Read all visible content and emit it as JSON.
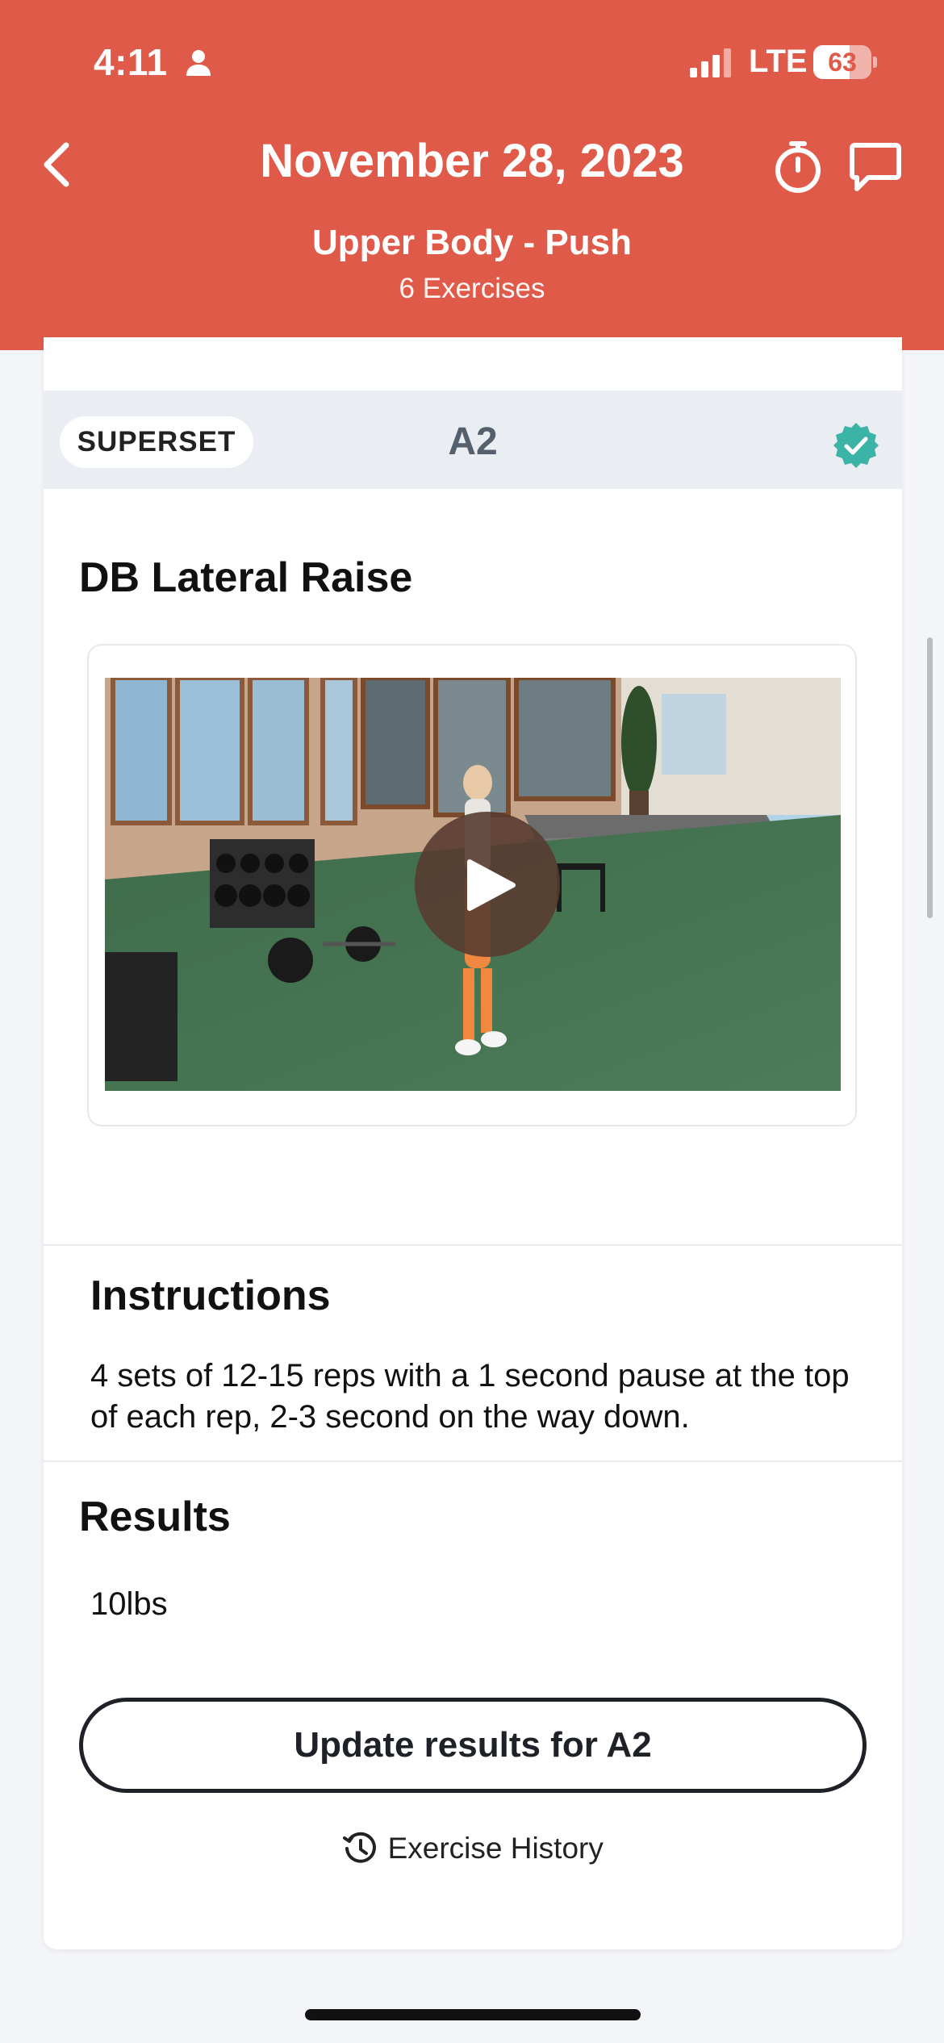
{
  "status_bar": {
    "time": "4:11",
    "network": "LTE",
    "battery_level": "63",
    "battery_fraction": 0.63
  },
  "header": {
    "date": "November 28, 2023",
    "workout_name": "Upper Body - Push",
    "exercise_count": "6 Exercises",
    "background_color": "#e05a49",
    "icons": [
      "person-icon",
      "cellular-signal-icon",
      "back-chevron-icon",
      "stopwatch-icon",
      "chat-bubble-icon"
    ]
  },
  "superset": {
    "tag": "SUPERSET",
    "code": "A2",
    "completed": true,
    "check_color": "#3bb3a6"
  },
  "exercise": {
    "title": "DB Lateral Raise",
    "video_icon": "play-icon"
  },
  "instructions": {
    "heading": "Instructions",
    "text": "4 sets of 12-15 reps with a 1 second pause at the top of each rep, 2-3 second on the way down."
  },
  "results": {
    "heading": "Results",
    "value": "10lbs",
    "update_button": "Update results for A2",
    "history_link": "Exercise History",
    "history_icon": "history-clock-icon"
  }
}
